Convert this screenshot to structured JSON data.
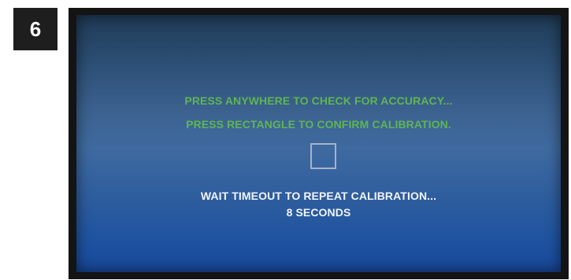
{
  "step": {
    "number": "6"
  },
  "screen": {
    "instruction_check": "PRESS ANYWHERE TO CHECK FOR ACCURACY...",
    "instruction_confirm": "PRESS RECTANGLE TO CONFIRM CALIBRATION.",
    "timeout_message": "WAIT TIMEOUT TO REPEAT CALIBRATION...",
    "countdown": "8 SECONDS"
  },
  "colors": {
    "instruction_text": "#5fb553",
    "timeout_text": "#f2f4f8",
    "badge_background": "#1e1e1e",
    "bezel": "#141414",
    "screen_top": "#1f3a55",
    "screen_bottom": "#17489a"
  }
}
